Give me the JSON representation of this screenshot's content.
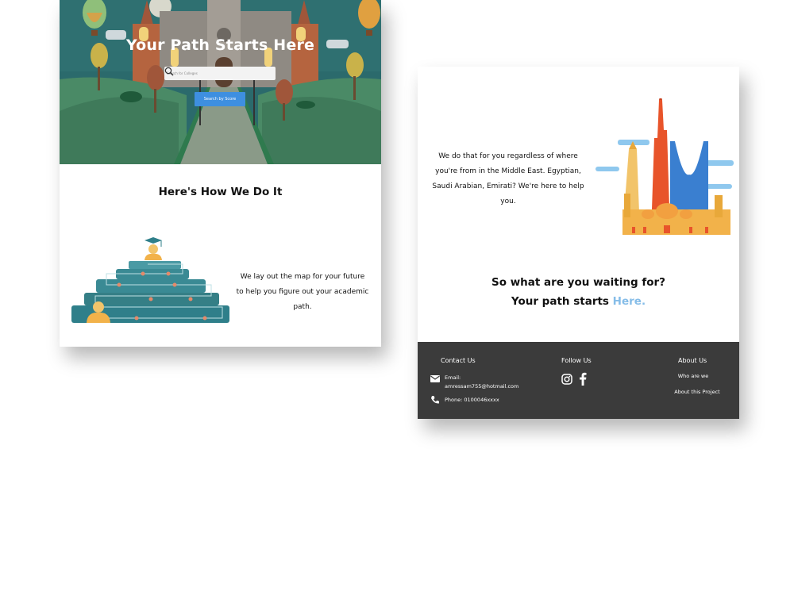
{
  "hero": {
    "title": "Your Path Starts Here",
    "search_placeholder": "Search for Colleges",
    "score_button": "Search by Score"
  },
  "how": {
    "title": "Here's How We Do It",
    "text": "We lay out the map for your future to help you figure out your academic path."
  },
  "mideast": {
    "text": "We do that for you regardless of where you're from in the Middle East. Egyptian, Saudi Arabian, Emirati? We're here to help you."
  },
  "cta": {
    "line1": "So what are you waiting for?",
    "line2_prefix": "Your path starts ",
    "link": "Here."
  },
  "footer": {
    "contact_heading": "Contact Us",
    "email_label": "Email:",
    "email_value": "amressam755@hotmail.com",
    "phone": "Phone: 0100046xxxx",
    "follow_heading": "Follow Us",
    "about_heading": "About Us",
    "about_links": [
      "Who are we",
      "About this Project"
    ]
  },
  "icons": [
    "search-icon",
    "email-icon",
    "phone-icon",
    "instagram-icon",
    "facebook-icon"
  ],
  "colors": {
    "accent_button": "#3e8fe0",
    "link": "#86bde8",
    "footer_bg": "#3b3b3b",
    "hero_bg": "#2a5f63",
    "pyramid": "#2f7f8a"
  }
}
